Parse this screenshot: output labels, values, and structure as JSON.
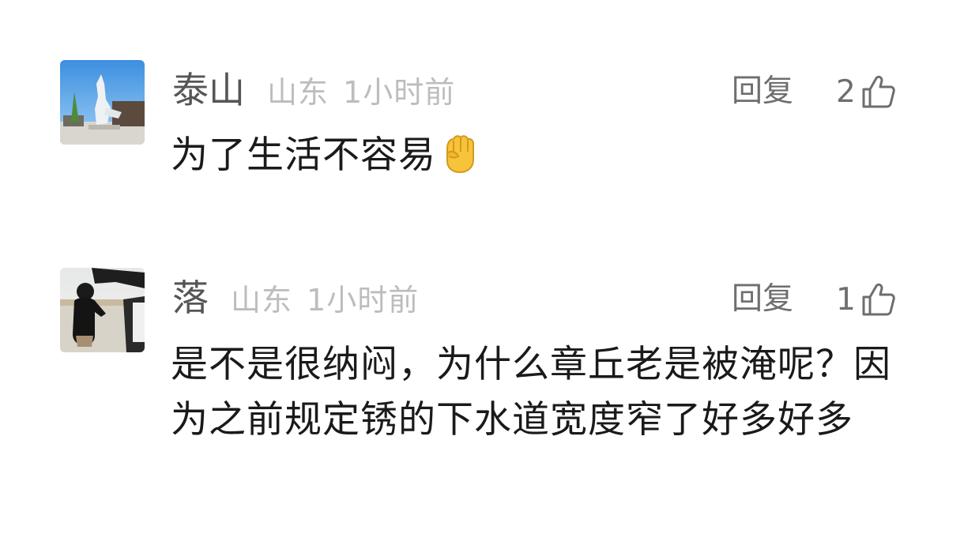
{
  "comments": [
    {
      "author": "泰山",
      "location": "山东",
      "time": "1小时前",
      "reply_label": "回复",
      "likes": "2",
      "text": "为了生活不容易",
      "emoji": "raised-fist"
    },
    {
      "author": "落",
      "location": "山东",
      "time": "1小时前",
      "reply_label": "回复",
      "likes": "1",
      "text": "是不是很纳闷，为什么章丘老是被淹呢？因为之前规定锈的下水道宽度窄了好多好多"
    }
  ],
  "colors": {
    "author": "#555555",
    "meta": "#bdbdbd",
    "action": "#6e6e6e",
    "text": "#1a1a1a"
  },
  "icons": {
    "like": "thumbs-up-outline-icon",
    "emoji": "raised-fist-emoji-icon"
  }
}
